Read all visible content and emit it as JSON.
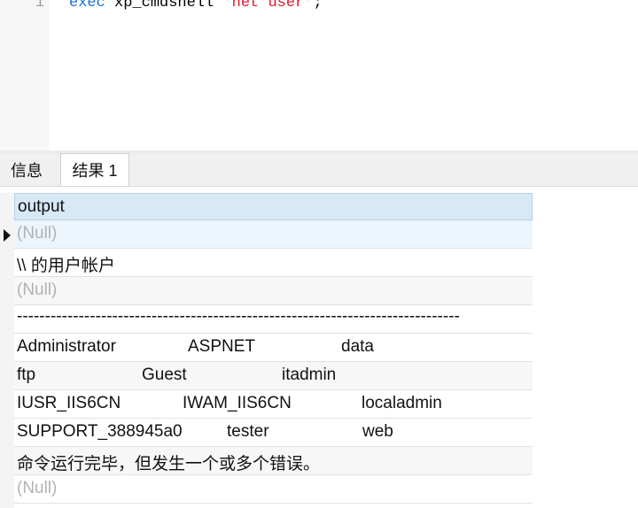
{
  "editor": {
    "line_number": "1",
    "code": {
      "keyword": "exec",
      "proc": " xp_cmdshell ",
      "string": "'net user'",
      "end": ";"
    }
  },
  "tabs": [
    {
      "label": "信息"
    },
    {
      "label": "结果 1"
    }
  ],
  "grid": {
    "column_header": "output",
    "rows": [
      {
        "text": "(Null)",
        "null": true
      },
      {
        "text": "\\\\ 的用户帐户"
      },
      {
        "text": "(Null)",
        "null": true
      },
      {
        "text": "-------------------------------------------------------------------------------"
      },
      {
        "cols": [
          "Administrator",
          "ASPNET",
          "data"
        ]
      },
      {
        "cols": [
          "ftp",
          "Guest",
          "itadmin"
        ]
      },
      {
        "cols": [
          "IUSR_IIS6CN",
          "IWAM_IIS6CN",
          "localadmin"
        ]
      },
      {
        "cols": [
          "SUPPORT_388945a0",
          "tester",
          "web"
        ]
      },
      {
        "text": "命令运行完毕，但发生一个或多个错误。"
      },
      {
        "text": "(Null)",
        "null": true
      }
    ]
  }
}
